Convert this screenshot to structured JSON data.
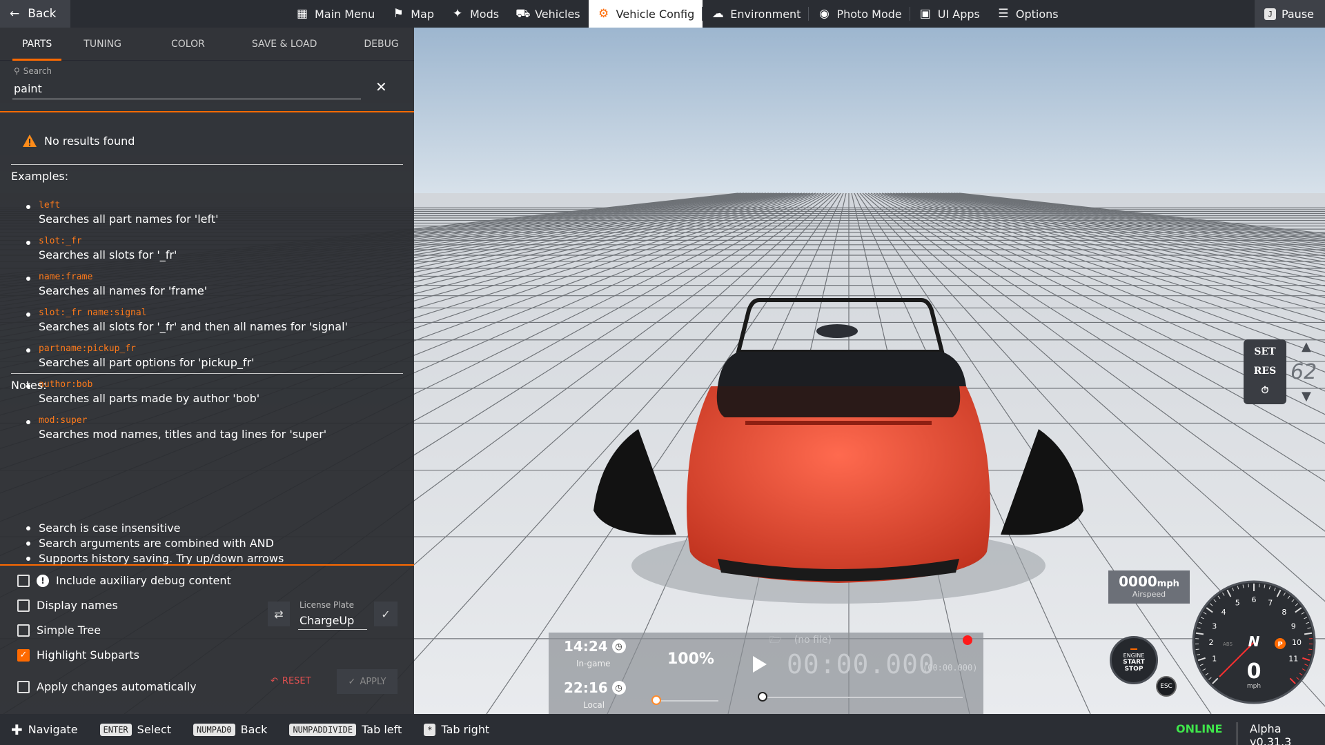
{
  "topbar": {
    "back_label": "Back",
    "nav": [
      {
        "label": "Main Menu",
        "icon": "menu-grid-icon"
      },
      {
        "label": "Map",
        "icon": "map-icon"
      },
      {
        "label": "Mods",
        "icon": "puzzle-icon"
      },
      {
        "label": "Vehicles",
        "icon": "car-icon"
      },
      {
        "label": "Vehicle Config",
        "icon": "engine-icon",
        "active": true
      },
      {
        "label": "Environment",
        "icon": "weather-icon"
      },
      {
        "label": "Photo Mode",
        "icon": "camera-icon"
      },
      {
        "label": "UI Apps",
        "icon": "apps-icon"
      },
      {
        "label": "Options",
        "icon": "sliders-icon"
      }
    ],
    "pause_label": "Pause",
    "pause_key": "J"
  },
  "panel": {
    "tabs": [
      "PARTS",
      "TUNING",
      "COLOR",
      "SAVE & LOAD",
      "DEBUG"
    ],
    "active_tab": "PARTS",
    "search": {
      "label": "Search",
      "value": "paint"
    },
    "no_results": "No results found",
    "examples_title": "Examples:",
    "examples": [
      {
        "code": "left",
        "desc": "Searches all part names for 'left'"
      },
      {
        "code": "slot:_fr",
        "desc": "Searches all slots for '_fr'"
      },
      {
        "code": "name:frame",
        "desc": "Searches all names for 'frame'"
      },
      {
        "code": "slot:_fr name:signal",
        "desc": "Searches all slots for '_fr' and then all names for 'signal'"
      },
      {
        "code": "partname:pickup_fr",
        "desc": "Searches all part options for 'pickup_fr'"
      },
      {
        "code": "author:bob",
        "desc": "Searches all parts made by author 'bob'"
      },
      {
        "code": "mod:super",
        "desc": "Searches mod names, titles and tag lines for 'super'"
      }
    ],
    "notes_title": "Notes:",
    "notes": [
      "Search is case insensitive",
      "Search arguments are combined with AND",
      "Supports history saving. Try up/down arrows"
    ],
    "options": {
      "aux_debug": {
        "label": "Include auxiliary debug content",
        "checked": false
      },
      "display_names": {
        "label": "Display names",
        "checked": false
      },
      "simple_tree": {
        "label": "Simple Tree",
        "checked": false
      },
      "highlight_subparts": {
        "label": "Highlight Subparts",
        "checked": true
      },
      "apply_auto": {
        "label": "Apply changes automatically",
        "checked": false
      }
    },
    "license_plate": {
      "label": "License Plate",
      "value": "ChargeUp"
    },
    "reset_label": "RESET",
    "apply_label": "APPLY"
  },
  "hud": {
    "cruise": {
      "set": "SET",
      "res": "RES",
      "speed": "62"
    },
    "airspeed": {
      "value": "0000",
      "unit": "mph",
      "label": "Airspeed"
    },
    "engine_button": {
      "line1": "ENGINE",
      "line2": "START",
      "line3": "STOP"
    },
    "esc_label": "ESC",
    "gauge": {
      "gear": "N",
      "speed": "0",
      "unit": "mph",
      "ticks": [
        "1",
        "2",
        "3",
        "4",
        "5",
        "6",
        "7",
        "8",
        "9",
        "10",
        "11"
      ],
      "abs": "ABS",
      "park": "P"
    }
  },
  "replay": {
    "ingame_time": "14:24",
    "ingame_label": "In-game",
    "local_time": "22:16",
    "local_label": "Local",
    "speed": "100%",
    "file": "(no file)",
    "time": "00:00.000",
    "time_small": "(00:00.000)",
    "speed_slider_fraction": 0.0,
    "position_fraction": 0.0
  },
  "bottombar": {
    "hints": [
      {
        "key": "",
        "label": "Navigate",
        "icon": "dpad-icon"
      },
      {
        "key": "ENTER",
        "label": "Select"
      },
      {
        "key": "NUMPAD0",
        "label": "Back"
      },
      {
        "key": "NUMPADDIVIDE",
        "label": "Tab left"
      },
      {
        "key": "*",
        "label": "Tab right"
      }
    ],
    "status": "ONLINE",
    "version": "Alpha v0.31.3"
  },
  "colors": {
    "accent": "#ff6a00",
    "online": "#3fe54b",
    "car": "#e8442c"
  }
}
